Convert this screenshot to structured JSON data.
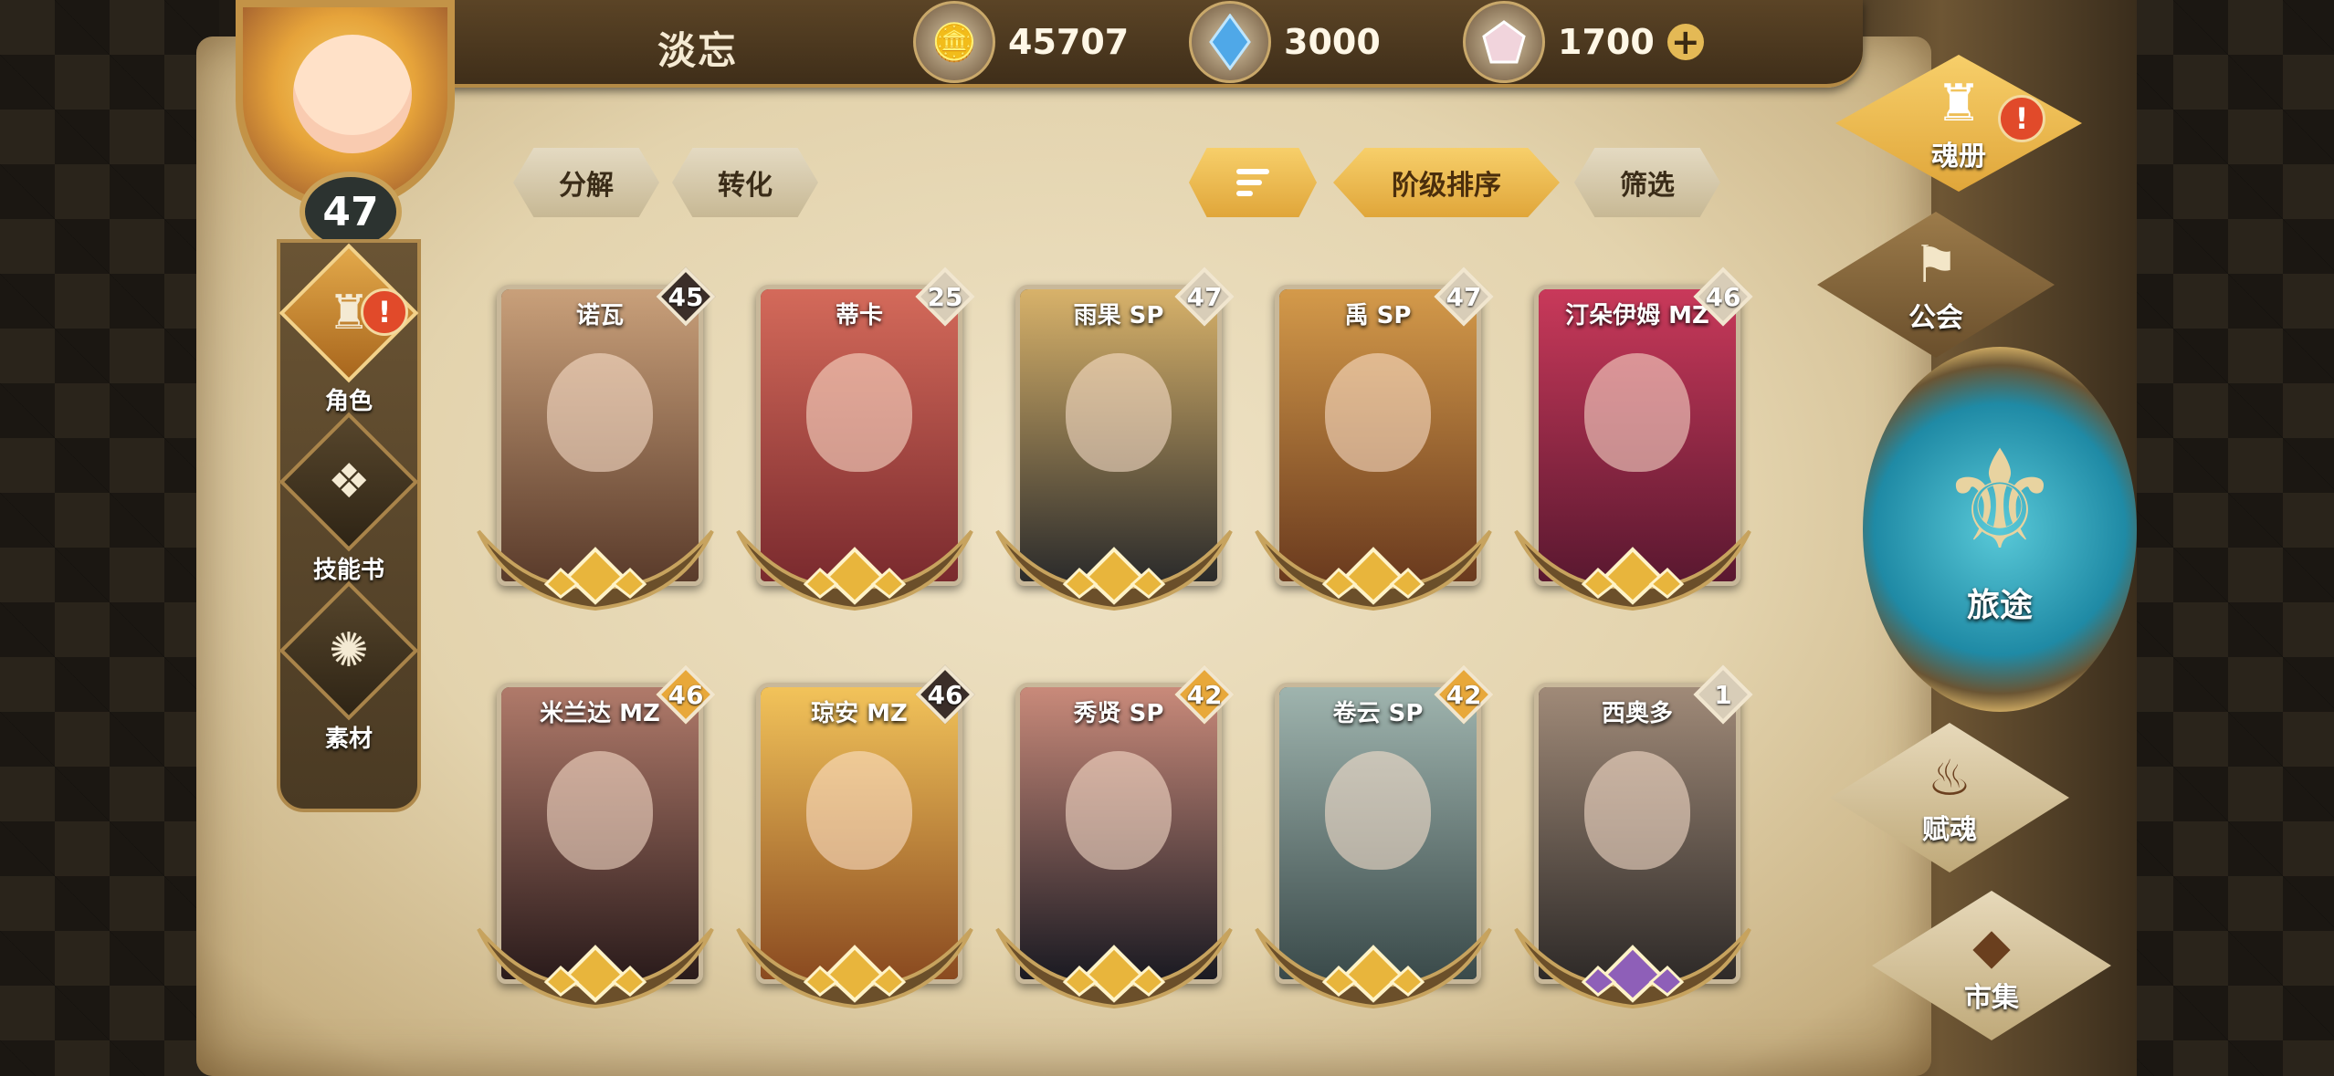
{
  "player": {
    "name": "淡忘",
    "level": "47"
  },
  "currencies": [
    {
      "icon": "gold-coin-icon",
      "value": "45707"
    },
    {
      "icon": "blue-crystal-icon",
      "value": "3000"
    },
    {
      "icon": "pink-gem-icon",
      "value": "1700"
    }
  ],
  "left_nav": [
    {
      "label": "角色",
      "icon": "character-helmet-icon",
      "active": true,
      "alert": true
    },
    {
      "label": "技能书",
      "icon": "skill-book-icon",
      "active": false,
      "alert": false
    },
    {
      "label": "素材",
      "icon": "material-beast-icon",
      "active": false,
      "alert": false
    }
  ],
  "toolbar": {
    "decompose": "分解",
    "convert": "转化",
    "sort_order": "阶级排序",
    "filter": "筛选"
  },
  "right_nav": [
    {
      "label": "魂册",
      "icon": "soul-book-icon",
      "alert": true
    },
    {
      "label": "公会",
      "icon": "guild-banner-icon",
      "alert": false
    },
    {
      "label": "旅途",
      "icon": "journey-emblem-icon",
      "alert": false
    },
    {
      "label": "赋魂",
      "icon": "soul-flame-icon",
      "alert": false
    },
    {
      "label": "市集",
      "icon": "market-gem-icon",
      "alert": false
    }
  ],
  "cards": [
    {
      "name": "诺瓦",
      "level": "45",
      "badge": "dark",
      "tier": "gold",
      "art": [
        "#5a3b2b",
        "#c9a07a"
      ]
    },
    {
      "name": "蒂卡",
      "level": "25",
      "badge": "light",
      "tier": "gold",
      "art": [
        "#7a2a2e",
        "#d46a5a"
      ]
    },
    {
      "name": "雨果 SP",
      "level": "47",
      "badge": "light",
      "tier": "gold",
      "art": [
        "#2b2b2b",
        "#d8b26a"
      ]
    },
    {
      "name": "禹 SP",
      "level": "47",
      "badge": "light",
      "tier": "gold",
      "art": [
        "#6a3a1e",
        "#d49a4a"
      ]
    },
    {
      "name": "汀朵伊姆 MZ",
      "level": "46",
      "badge": "light",
      "tier": "gold",
      "art": [
        "#5a1830",
        "#c9395a"
      ]
    },
    {
      "name": "米兰达 MZ",
      "level": "46",
      "badge": "gold",
      "tier": "gold",
      "art": [
        "#2a1b1b",
        "#b07a6a"
      ]
    },
    {
      "name": "琼安 MZ",
      "level": "46",
      "badge": "dark",
      "tier": "gold",
      "art": [
        "#8a4a20",
        "#f2c35a"
      ]
    },
    {
      "name": "秀贤 SP",
      "level": "42",
      "badge": "gold",
      "tier": "gold",
      "art": [
        "#1a1a22",
        "#c98a7a"
      ]
    },
    {
      "name": "卷云 SP",
      "level": "42",
      "badge": "gold",
      "tier": "gold",
      "art": [
        "#3a4a4a",
        "#9fb4ae"
      ]
    },
    {
      "name": "西奥多",
      "level": "1",
      "badge": "light",
      "tier": "purple",
      "art": [
        "#2e2a28",
        "#a08a78"
      ]
    }
  ],
  "colors": {
    "badge_dark": "#3b2e29",
    "badge_light": "#d8cdb8",
    "badge_gold": "#e8a83a",
    "tier_gold": "#e8b53c",
    "tier_purple": "#8e5fb8"
  }
}
